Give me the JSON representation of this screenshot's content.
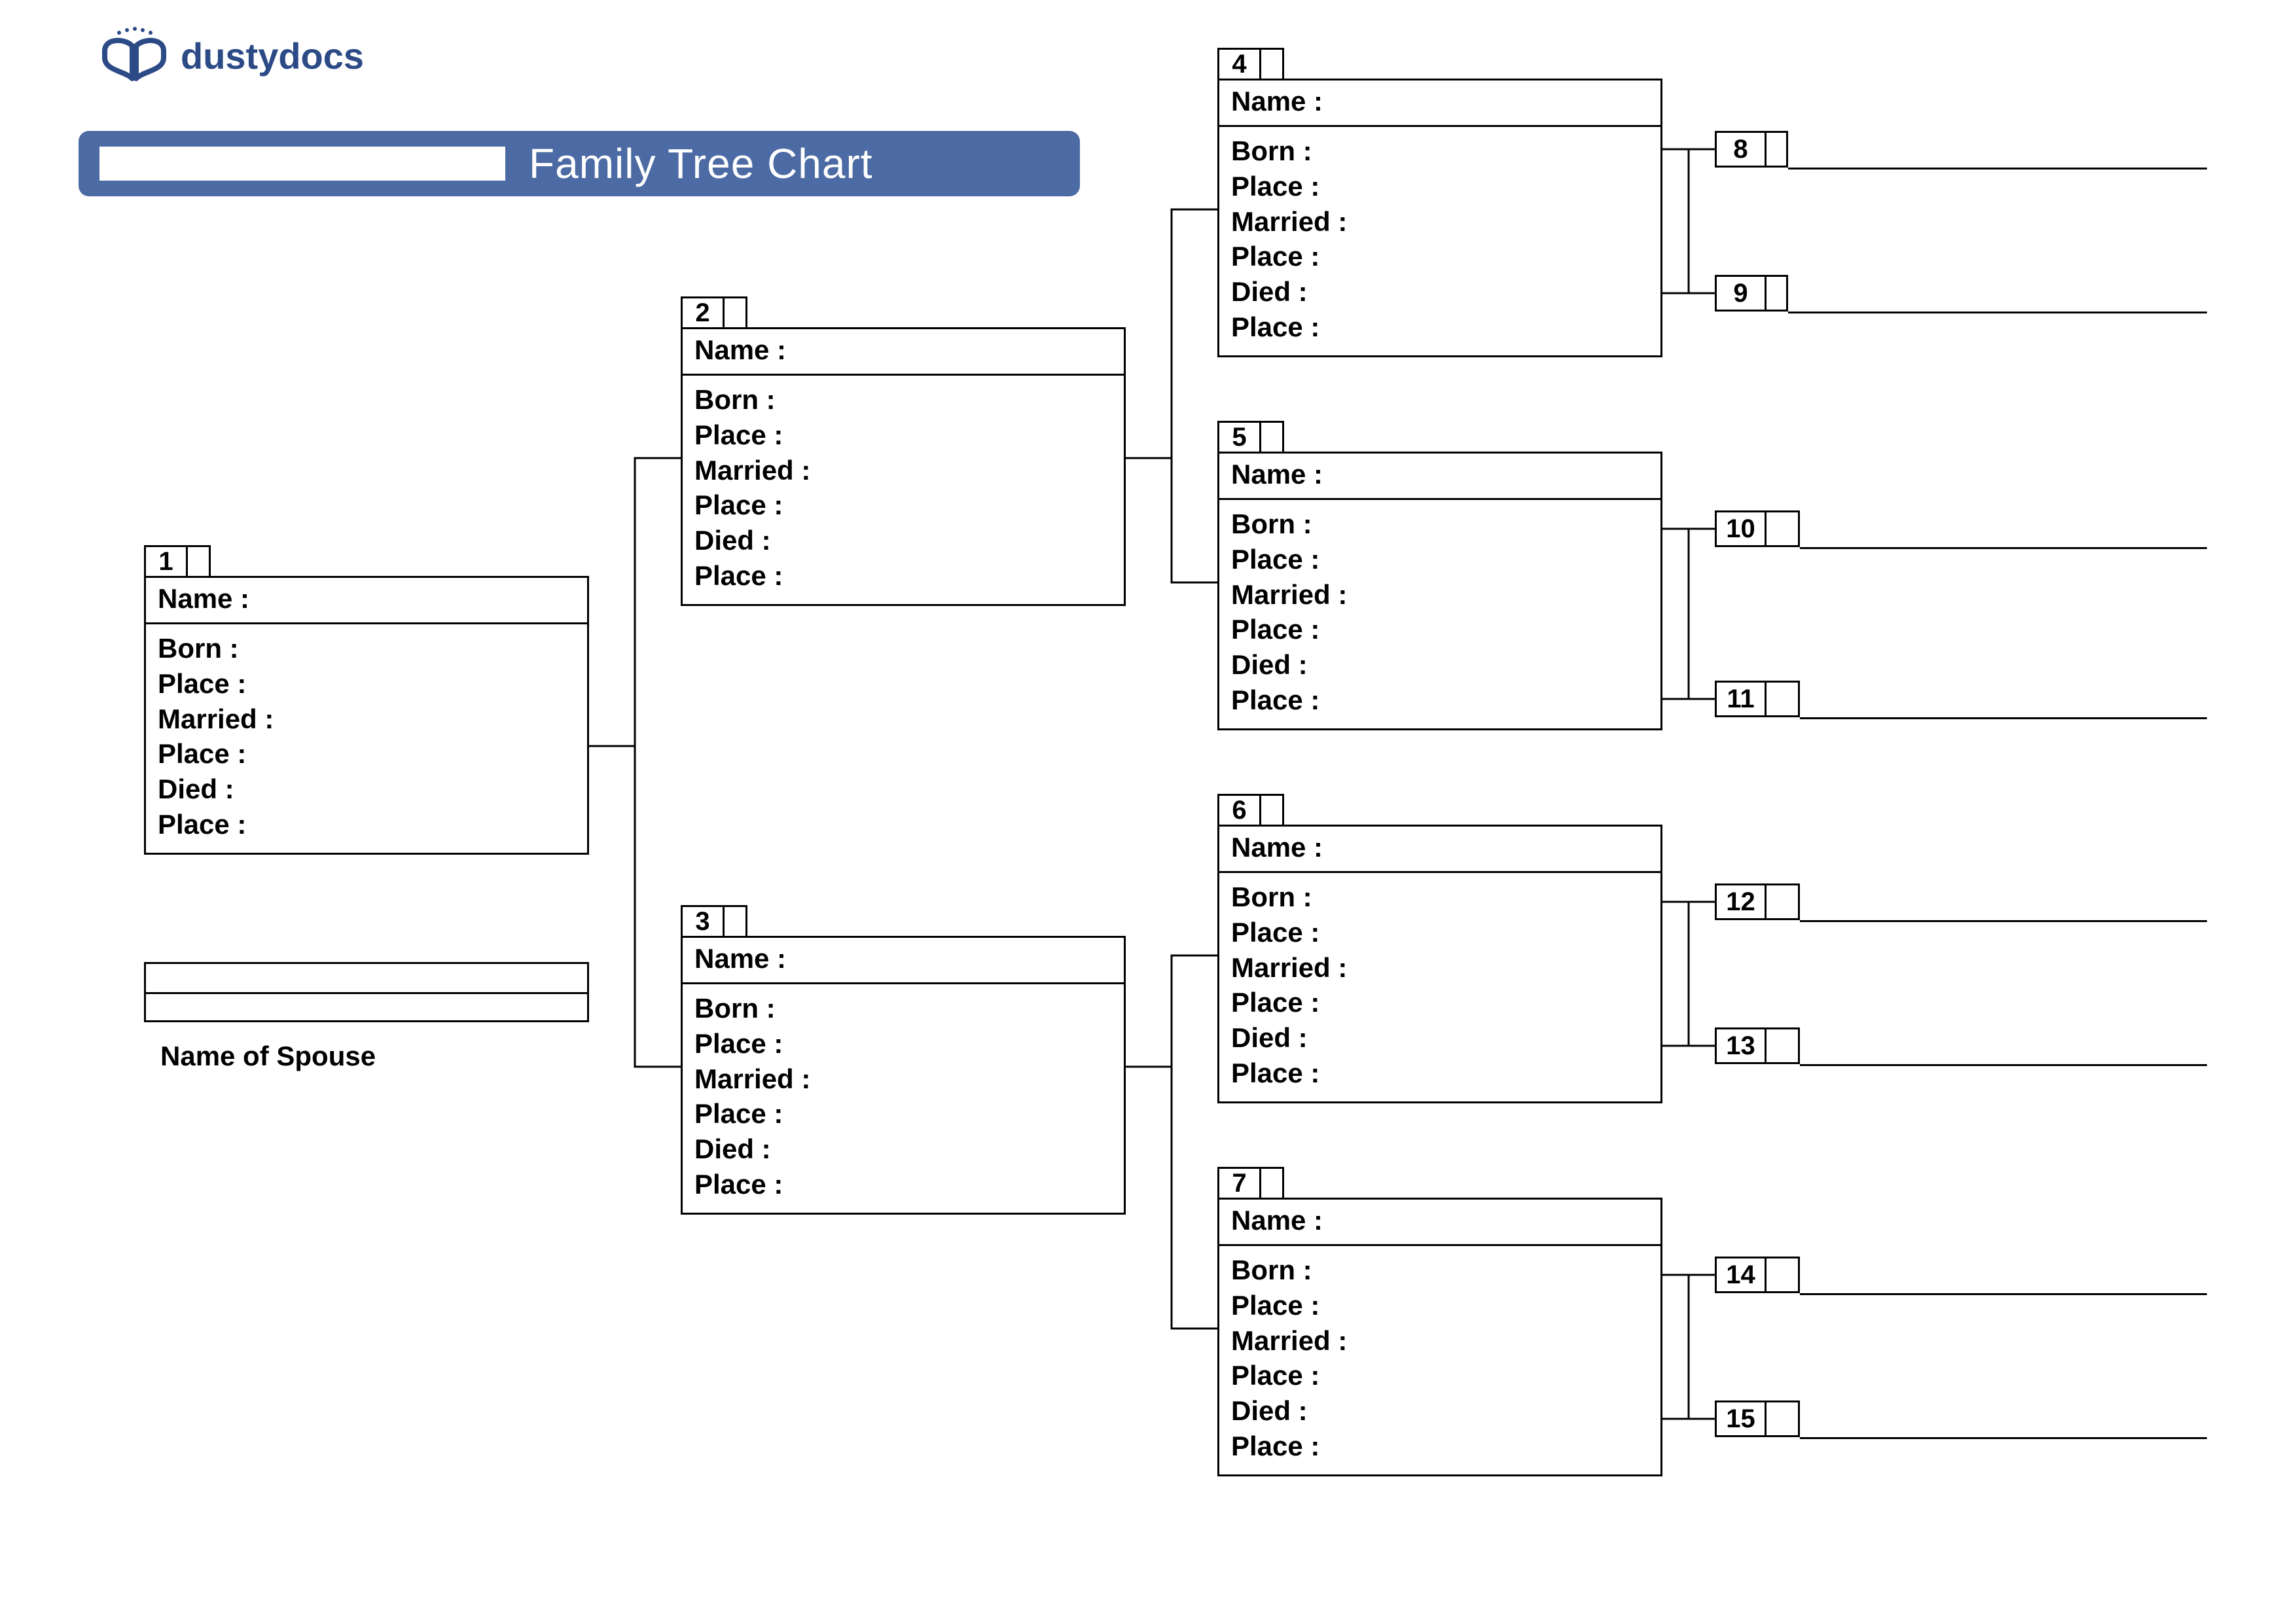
{
  "brand": {
    "name": "dustydocs"
  },
  "header": {
    "title": "Family Tree Chart"
  },
  "labels": {
    "name": "Name :",
    "born": "Born :",
    "place": "Place :",
    "married": "Married :",
    "died": "Died :",
    "spouse_caption": "Name of Spouse"
  },
  "people": {
    "p1": {
      "num": "1"
    },
    "p2": {
      "num": "2"
    },
    "p3": {
      "num": "3"
    },
    "p4": {
      "num": "4"
    },
    "p5": {
      "num": "5"
    },
    "p6": {
      "num": "6"
    },
    "p7": {
      "num": "7"
    }
  },
  "slots": {
    "s8": {
      "num": "8"
    },
    "s9": {
      "num": "9"
    },
    "s10": {
      "num": "10"
    },
    "s11": {
      "num": "11"
    },
    "s12": {
      "num": "12"
    },
    "s13": {
      "num": "13"
    },
    "s14": {
      "num": "14"
    },
    "s15": {
      "num": "15"
    }
  }
}
